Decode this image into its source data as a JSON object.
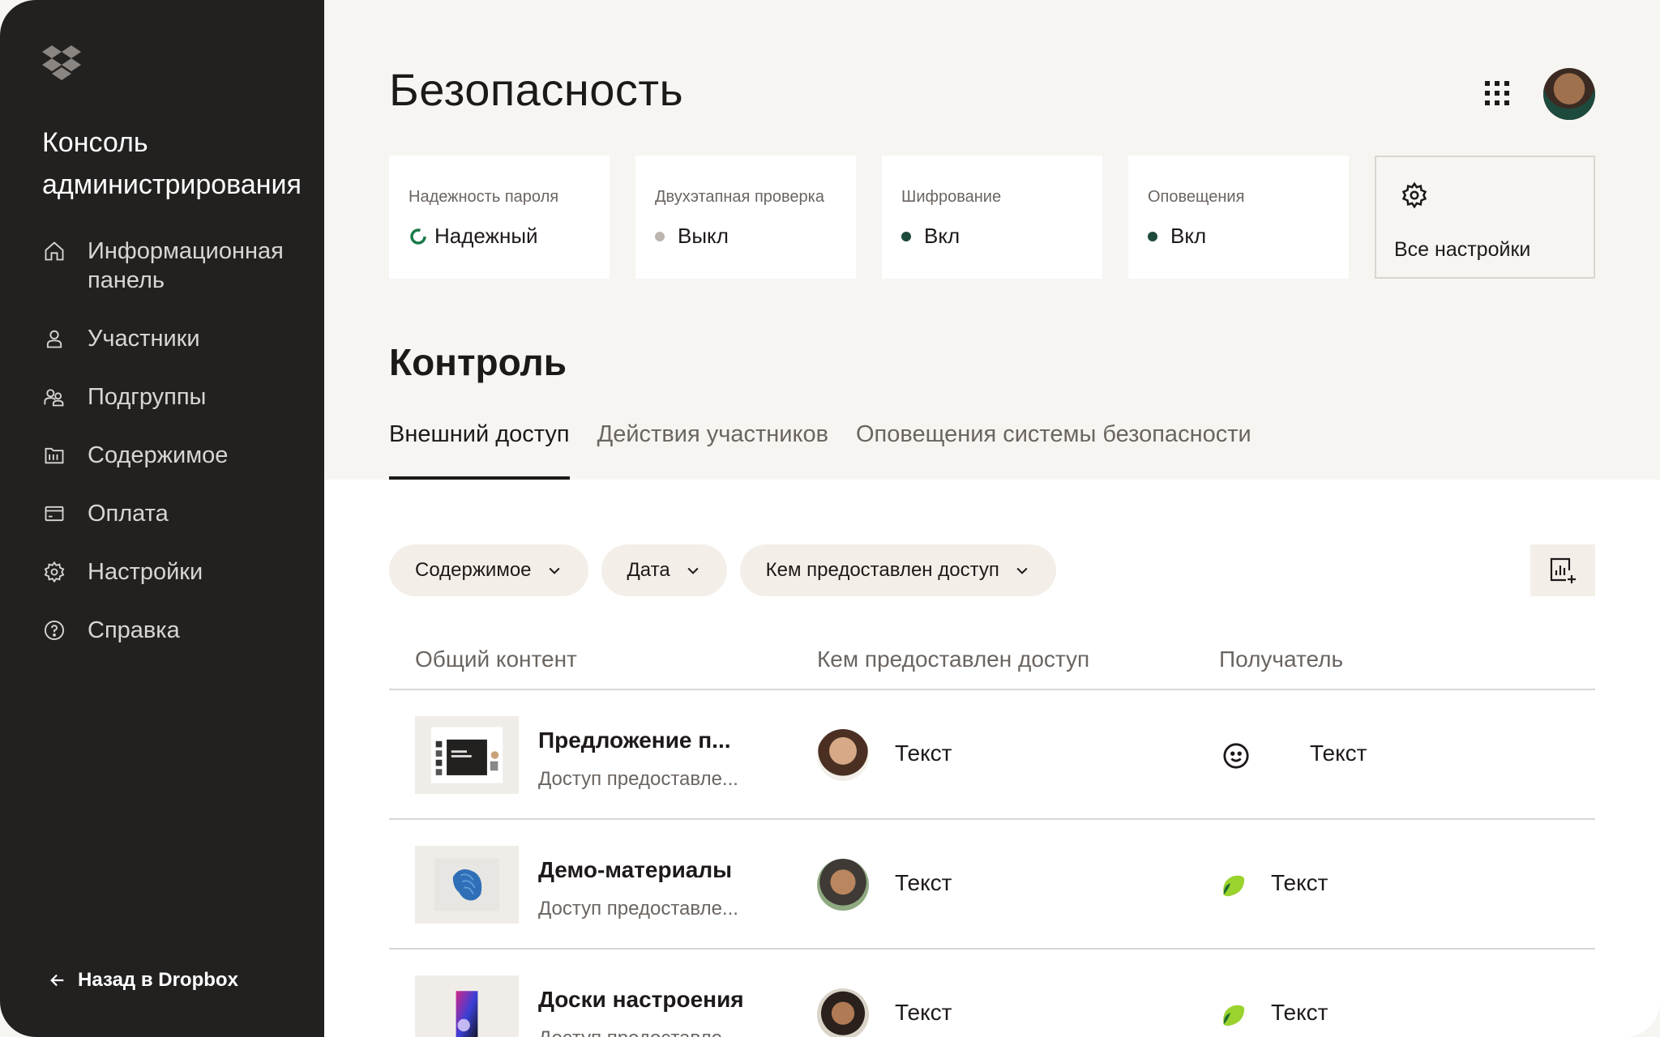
{
  "app": {
    "console_title": "Консоль администрирования",
    "back_label": "Назад в Dropbox"
  },
  "sidebar": {
    "items": [
      {
        "label": "Информационная панель",
        "icon": "home-icon"
      },
      {
        "label": "Участники",
        "icon": "person-icon"
      },
      {
        "label": "Подгруппы",
        "icon": "group-icon"
      },
      {
        "label": "Содержимое",
        "icon": "folder-icon"
      },
      {
        "label": "Оплата",
        "icon": "card-icon"
      },
      {
        "label": "Настройки",
        "icon": "gear-icon"
      },
      {
        "label": "Справка",
        "icon": "help-icon"
      }
    ]
  },
  "header": {
    "title": "Безопасность"
  },
  "cards": [
    {
      "label": "Надежность пароля",
      "value": "Надежный",
      "status_color": "#1a7a4a"
    },
    {
      "label": "Двухэтапная проверка",
      "value": "Выкл",
      "status_color": "#bbb5ae"
    },
    {
      "label": "Шифрование",
      "value": "Вкл",
      "status_color": "#1d4a3c"
    },
    {
      "label": "Оповещения",
      "value": "Вкл",
      "status_color": "#1d4a3c"
    },
    {
      "label": "",
      "value": "Все настройки"
    }
  ],
  "control": {
    "title": "Контроль",
    "tabs": [
      {
        "label": "Внешний доступ",
        "active": true
      },
      {
        "label": "Действия участников",
        "active": false
      },
      {
        "label": "Оповещения системы безопасности",
        "active": false
      }
    ],
    "filters": [
      {
        "label": "Содержимое"
      },
      {
        "label": "Дата"
      },
      {
        "label": "Кем предоставлен доступ"
      }
    ]
  },
  "table": {
    "columns": [
      "Общий контент",
      "Кем предоставлен доступ",
      "Получатель"
    ],
    "rows": [
      {
        "name": "Предложение п...",
        "sub": "Доступ предоставле...",
        "shared_by": "Текст",
        "recipient": "Текст",
        "recipient_icon": "smiley-icon"
      },
      {
        "name": "Демо-материалы",
        "sub": "Доступ предоставле...",
        "shared_by": "Текст",
        "recipient": "Текст",
        "recipient_icon": "leaf-icon"
      },
      {
        "name": "Доски настроения",
        "sub": "Доступ предоставле...",
        "shared_by": "Текст",
        "recipient": "Текст",
        "recipient_icon": "leaf-icon"
      }
    ]
  },
  "colors": {
    "sidebar_bg": "#232120",
    "page_bg": "#f7f5f2",
    "chip_bg": "#f3efe8",
    "accent_green": "#1d4a3c"
  }
}
